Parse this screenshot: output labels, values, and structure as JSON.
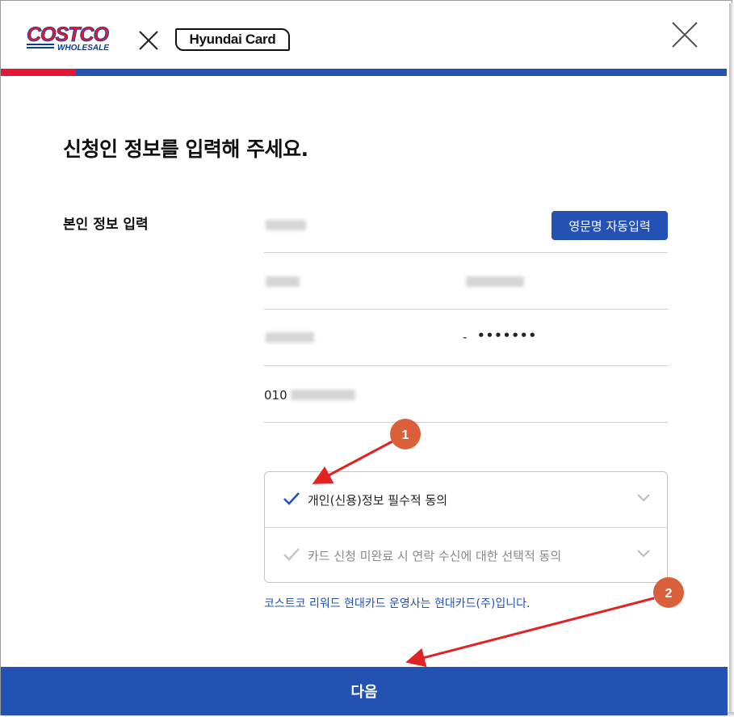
{
  "header": {
    "brand_costco_top": "COSTCO",
    "brand_costco_bottom": "WHOLESALE",
    "brand_partner": "Hyundai Card",
    "separator": "×"
  },
  "page": {
    "title": "신청인 정보를 입력해 주세요.",
    "section_label": "본인 정보 입력",
    "auto_fill_button": "영문명 자동입력"
  },
  "fields": {
    "id_dash": "-",
    "id_masked": "•••••••",
    "phone_prefix": "010"
  },
  "agreements": [
    {
      "label": "개인(신용)정보 필수적 동의",
      "checked": true,
      "check_color": "#2452b3"
    },
    {
      "label": "카드 신청 미완료 시 연락 수신에 대한 선택적 동의",
      "checked": false,
      "check_color": "#c8c8c8"
    }
  ],
  "notice": "코스트코 리워드 현대카드 운영사는 현대카드(주)입니다.",
  "next_button": "다음",
  "annotations": [
    {
      "number": "1"
    },
    {
      "number": "2"
    }
  ],
  "colors": {
    "accent_blue": "#2452b3",
    "brand_red": "#e31837",
    "annotation": "#d9603b",
    "arrow": "#e02424"
  }
}
